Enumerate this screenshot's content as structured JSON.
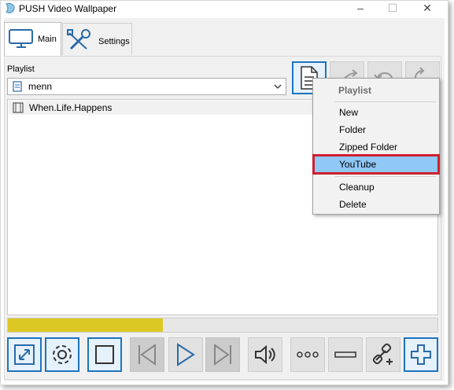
{
  "window": {
    "title": "PUSH Video Wallpaper",
    "minimize": "–",
    "maximize": "☐",
    "close": "✕"
  },
  "tabs": [
    {
      "label": "Main",
      "icon": "monitor-icon",
      "active": true
    },
    {
      "label": "Settings",
      "icon": "tools-icon",
      "active": false
    }
  ],
  "playlist": {
    "label": "Playlist",
    "selected": "menn"
  },
  "items": [
    {
      "name": "When.Life.Happens"
    }
  ],
  "playback": {
    "progress_fraction": 0.36,
    "progress_color": "#dcc825"
  },
  "menu": {
    "header": "Playlist",
    "items": [
      {
        "label": "New",
        "highlighted": false
      },
      {
        "label": "Folder",
        "highlighted": false
      },
      {
        "label": "Zipped Folder",
        "highlighted": false
      },
      {
        "label": "YouTube",
        "highlighted": true
      },
      {
        "label": "Cleanup",
        "highlighted": false
      },
      {
        "label": "Delete",
        "highlighted": false
      }
    ]
  },
  "colors": {
    "accent": "#1c74bf",
    "highlight_bg": "#90c8f6",
    "highlight_border": "#d0202f"
  }
}
